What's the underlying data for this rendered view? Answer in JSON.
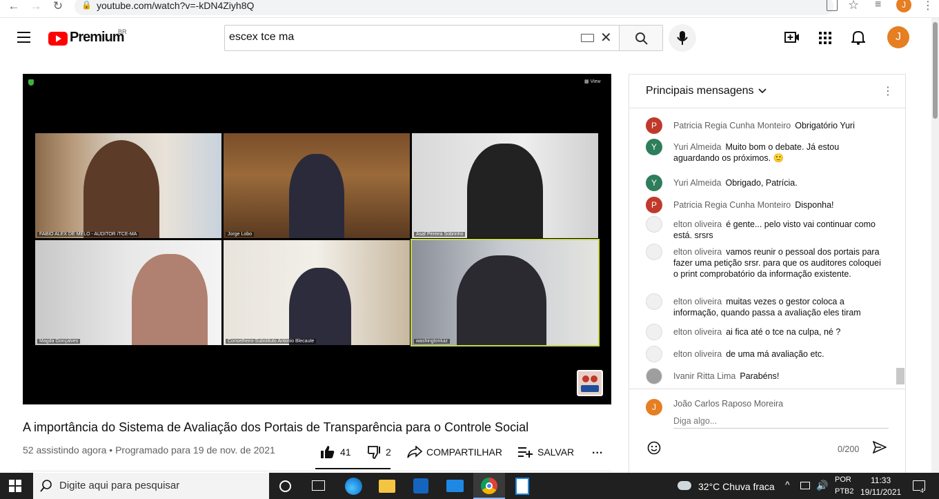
{
  "browser": {
    "url": "youtube.com/watch?v=-kDN4Ziyh8Q",
    "profile_initial": "J"
  },
  "header": {
    "logo_text": "Premium",
    "logo_region": "BR",
    "search_value": "escex tce ma",
    "avatar_initial": "J",
    "avatar_color": "#e67e22"
  },
  "video": {
    "view_label": "View",
    "participants": [
      {
        "name": "FABIO ALEX DE MELO - AUDITOR /TCE-MA"
      },
      {
        "name": "Jorge Lobo"
      },
      {
        "name": "Asaf Pereira Sobrinho"
      },
      {
        "name": "Magda Gonçalves"
      },
      {
        "name": "Conselheiro-Substituto Antonio Blecaute"
      },
      {
        "name": "washingtonluiz"
      }
    ],
    "title": "A importância do Sistema de Avaliação dos Portais de Transparência para o Controle Social",
    "meta": "52 assistindo agora • Programado para 19 de nov. de 2021",
    "likes": "41",
    "dislikes": "2",
    "share_label": "COMPARTILHAR",
    "save_label": "SALVAR",
    "more_label": "..."
  },
  "chat": {
    "title": "Principais mensagens",
    "messages": [
      {
        "initial": "P",
        "color": "#c0392b",
        "author": "Patricia Regia Cunha Monteiro",
        "text": "Obrigatório Yuri"
      },
      {
        "initial": "Y",
        "color": "#2e7d5b",
        "author": "Yuri Almeida",
        "text": "Muito bom o debate. Já estou aguardando os próximos. 🙂"
      },
      {
        "initial": "Y",
        "color": "#2e7d5b",
        "author": "Yuri Almeida",
        "text": "Obrigado, Patrícia."
      },
      {
        "initial": "P",
        "color": "#c0392b",
        "author": "Patricia Regia Cunha Monteiro",
        "text": "Disponha!"
      },
      {
        "initial": "",
        "color": "#f0f0f0",
        "author": "elton oliveira",
        "text": "é gente... pelo visto vai continuar como está. srsrs"
      },
      {
        "initial": "",
        "color": "#f0f0f0",
        "author": "elton oliveira",
        "text": "vamos reunir o pessoal dos portais para fazer uma petição srsr. para que os auditores coloquei o print comprobatório da informação existente."
      },
      {
        "initial": "",
        "color": "#f0f0f0",
        "author": "elton oliveira",
        "text": "muitas vezes o gestor coloca a informação, quando passa a avaliação eles tiram"
      },
      {
        "initial": "",
        "color": "#f0f0f0",
        "author": "elton oliveira",
        "text": "ai fica até o tce na culpa, né ?"
      },
      {
        "initial": "",
        "color": "#f0f0f0",
        "author": "elton oliveira",
        "text": "de uma má avaliação etc."
      },
      {
        "initial": "",
        "color": "#9e9e9e",
        "author": "Ivanir Ritta Lima",
        "text": "Parabéns!"
      }
    ],
    "compose_author": "João Carlos Raposo Moreira",
    "compose_initial": "J",
    "compose_placeholder": "Diga algo...",
    "char_count": "0/200"
  },
  "taskbar": {
    "search_placeholder": "Digite aqui para pesquisar",
    "weather": "32°C  Chuva fraca",
    "lang_top": "POR",
    "lang_bottom": "PTB2",
    "time": "11:33",
    "date": "19/11/2021",
    "notif_count": "4"
  }
}
